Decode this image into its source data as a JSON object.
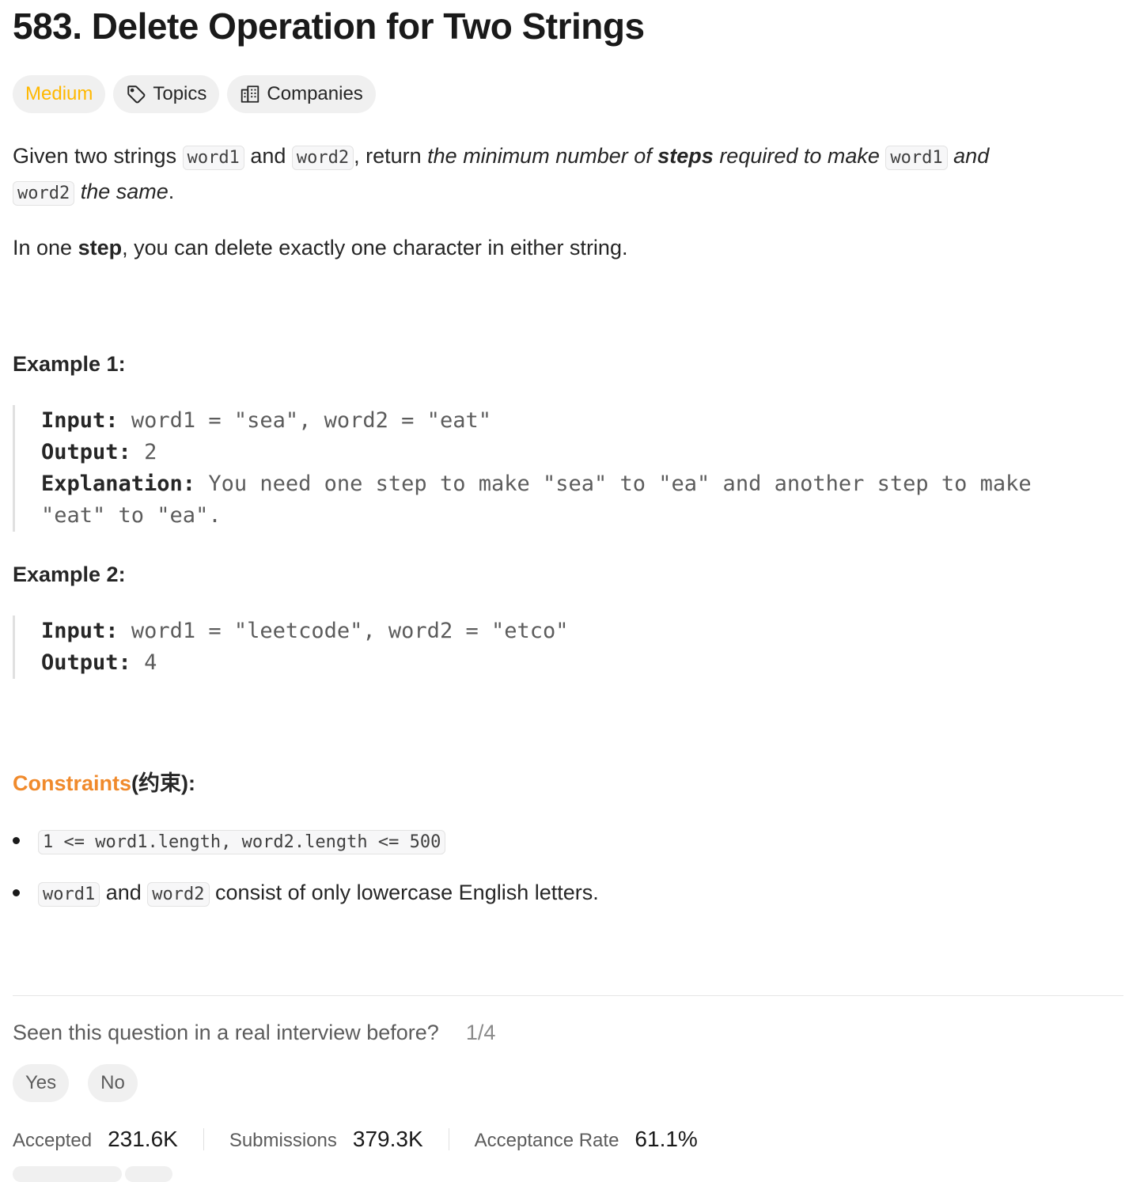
{
  "problem": {
    "title": "583. Delete Operation for Two Strings",
    "difficulty": "Medium",
    "topics_label": "Topics",
    "companies_label": "Companies"
  },
  "description": {
    "p1": {
      "t1": "Given two strings ",
      "c1": "word1",
      "t2": " and ",
      "c2": "word2",
      "t3": ", return ",
      "i1": "the minimum number of ",
      "b1": "steps",
      "i2": " required to make ",
      "c3": "word1",
      "i3": " and",
      "c4": "word2",
      "i4": " the same",
      "t4": "."
    },
    "p2": {
      "t1": "In one ",
      "b1": "step",
      "t2": ", you can delete exactly one character in either string."
    }
  },
  "examples": [
    {
      "heading": "Example 1:",
      "input_label": "Input:",
      "input": "word1 = \"sea\", word2 = \"eat\"",
      "output_label": "Output:",
      "output": "2",
      "explanation_label": "Explanation:",
      "explanation_line1": "You need one step to make \"sea\" to \"ea\" and another step to make",
      "explanation_line2": "\"eat\" to \"ea\"."
    },
    {
      "heading": "Example 2:",
      "input_label": "Input:",
      "input": "word1 = \"leetcode\", word2 = \"etco\"",
      "output_label": "Output:",
      "output": "4"
    }
  ],
  "constraints": {
    "title": "Constraints",
    "title_suffix": "(约束):",
    "item1_code": "1 <= word1.length, word2.length <= 500",
    "item2": {
      "c1": "word1",
      "t1": " and ",
      "c2": "word2",
      "t2": " consist of only lowercase English letters."
    }
  },
  "feedback": {
    "question": "Seen this question in a real interview before?",
    "counter": "1/4",
    "yes": "Yes",
    "no": "No"
  },
  "stats": {
    "accepted_label": "Accepted",
    "accepted_value": "231.6K",
    "submissions_label": "Submissions",
    "submissions_value": "379.3K",
    "rate_label": "Acceptance Rate",
    "rate_value": "61.1%"
  },
  "colors": {
    "difficulty_medium": "#ffb800",
    "constraints_accent": "#f08a2c"
  },
  "icons": {
    "topics": "tag-icon",
    "companies": "building-icon"
  }
}
